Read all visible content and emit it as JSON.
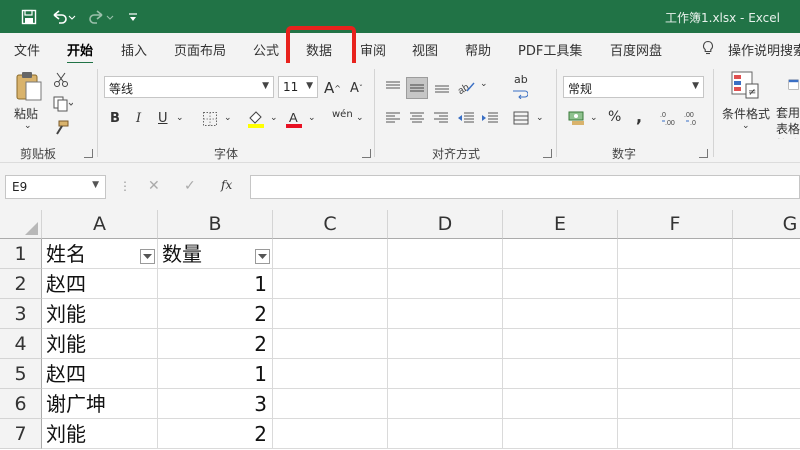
{
  "titlebar": {
    "doc_title": "工作簿1.xlsx  -  Excel",
    "bg_color": "#217346",
    "quick_access": [
      "save-icon",
      "undo-icon",
      "redo-icon",
      "customize-icon"
    ]
  },
  "ribbon_tabs": [
    {
      "label": "文件"
    },
    {
      "label": "开始",
      "active": true
    },
    {
      "label": "插入"
    },
    {
      "label": "页面布局"
    },
    {
      "label": "公式"
    },
    {
      "label": "数据",
      "highlighted": true
    },
    {
      "label": "审阅"
    },
    {
      "label": "视图"
    },
    {
      "label": "帮助"
    },
    {
      "label": "PDF工具集"
    },
    {
      "label": "百度网盘"
    }
  ],
  "tell_me": {
    "label": "操作说明搜索"
  },
  "ribbon": {
    "clipboard": {
      "paste_label": "粘贴",
      "group_label": "剪贴板"
    },
    "font": {
      "font_name": "等线",
      "font_size": "11",
      "bold": "B",
      "italic": "I",
      "underline": "U",
      "phonetic": "wén",
      "font_color": "#e81123",
      "fill_color": "#ffff00",
      "group_label": "字体"
    },
    "alignment": {
      "wrap_label": "ab",
      "group_label": "对齐方式"
    },
    "number": {
      "format": "常规",
      "percent": "%",
      "comma": ",",
      "group_label": "数字"
    },
    "styles": {
      "cond_format_label": "条件格式",
      "table_format_label": "套用表格格式"
    }
  },
  "formula_bar": {
    "name_box": "E9",
    "fx": "fx",
    "formula": ""
  },
  "grid": {
    "columns": [
      "A",
      "B",
      "C",
      "D",
      "E",
      "F",
      "G"
    ],
    "header_row": {
      "num": "1",
      "a": "姓名",
      "b": "数量"
    },
    "rows": [
      {
        "num": "2",
        "a": "赵四",
        "b": "1"
      },
      {
        "num": "3",
        "a": "刘能",
        "b": "2"
      },
      {
        "num": "4",
        "a": "刘能",
        "b": "2"
      },
      {
        "num": "5",
        "a": "赵四",
        "b": "1"
      },
      {
        "num": "6",
        "a": "谢广坤",
        "b": "3"
      },
      {
        "num": "7",
        "a": "刘能",
        "b": "2"
      }
    ]
  }
}
